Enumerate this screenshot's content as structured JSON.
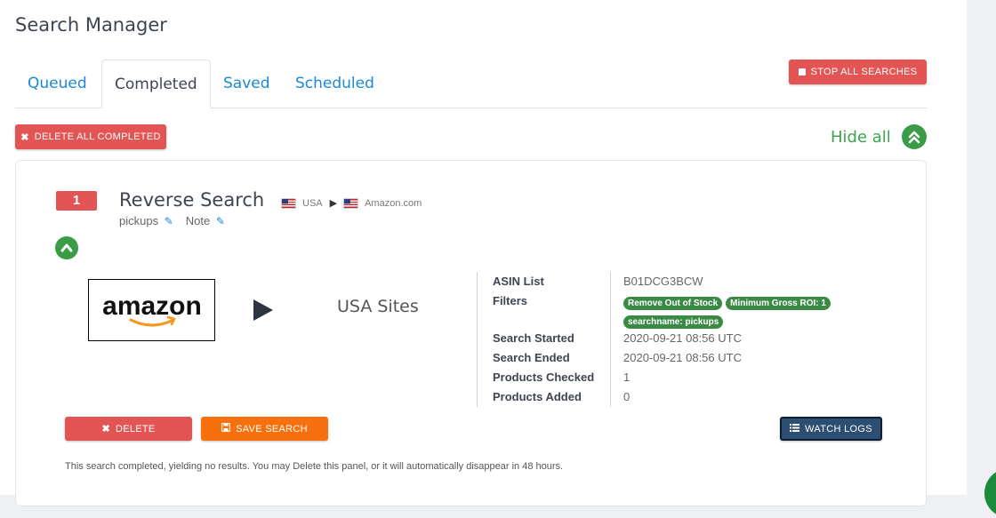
{
  "page": {
    "title": "Search Manager"
  },
  "tabs": [
    {
      "label": "Queued",
      "active": false
    },
    {
      "label": "Completed",
      "active": true
    },
    {
      "label": "Saved",
      "active": false
    },
    {
      "label": "Scheduled",
      "active": false
    }
  ],
  "toolbar": {
    "stop_all_label": "STOP ALL SEARCHES",
    "delete_all_label": "DELETE ALL COMPLETED",
    "hide_all_label": "Hide all"
  },
  "search": {
    "number": "1",
    "title": "Reverse Search",
    "source_country": "USA",
    "destination": "Amazon.com",
    "search_name": "pickups",
    "note_label": "Note",
    "target_label": "USA Sites",
    "logo_text": "amazon",
    "info": {
      "asin_list_label": "ASIN List",
      "asin_list_value": "B01DCG3BCW",
      "filters_label": "Filters",
      "filters": [
        "Remove Out of Stock",
        "Minimum Gross ROI: 1",
        "searchname: pickups"
      ],
      "started_label": "Search Started",
      "started_value": "2020-09-21 08:56 UTC",
      "ended_label": "Search Ended",
      "ended_value": "2020-09-21 08:56 UTC",
      "checked_label": "Products Checked",
      "checked_value": "1",
      "added_label": "Products Added",
      "added_value": "0"
    },
    "actions": {
      "delete_label": "DELETE",
      "save_label": "SAVE SEARCH",
      "logs_label": "WATCH LOGS"
    },
    "footer_note": "This search completed, yielding no results. You may Delete this panel, or it will automatically disappear in 48 hours."
  },
  "colors": {
    "danger": "#e35454",
    "warning": "#f7700e",
    "primary_link": "#1a8ad4",
    "success": "#3a9c46",
    "navy": "#2d4e73"
  }
}
